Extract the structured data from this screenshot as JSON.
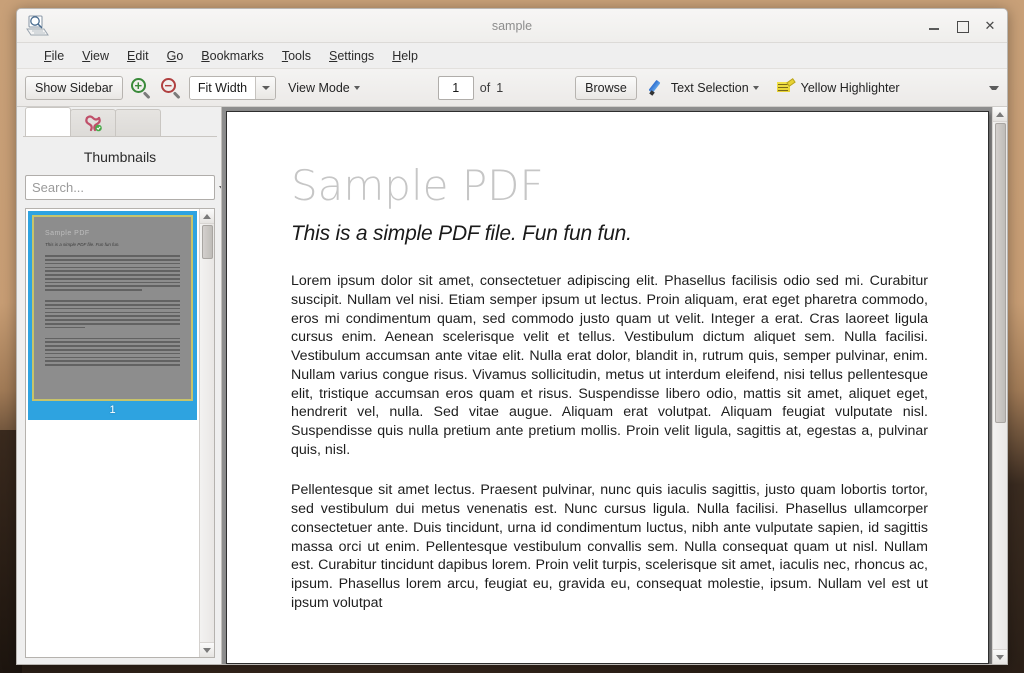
{
  "window": {
    "title": "sample",
    "app_icon": "okular-icon",
    "controls": {
      "minimize": "minimize-button",
      "maximize": "maximize-button",
      "close": "✕"
    }
  },
  "menubar": {
    "items": [
      {
        "label": "File",
        "mnemonic": "F"
      },
      {
        "label": "View",
        "mnemonic": "V"
      },
      {
        "label": "Edit",
        "mnemonic": "E"
      },
      {
        "label": "Go",
        "mnemonic": "G"
      },
      {
        "label": "Bookmarks",
        "mnemonic": "B"
      },
      {
        "label": "Tools",
        "mnemonic": "T"
      },
      {
        "label": "Settings",
        "mnemonic": "S"
      },
      {
        "label": "Help",
        "mnemonic": "H"
      }
    ]
  },
  "toolbar": {
    "show_sidebar": "Show Sidebar",
    "zoom_in_icon": "zoom-in-icon",
    "zoom_out_icon": "zoom-out-icon",
    "zoom_level": "Fit Width",
    "view_mode": "View Mode",
    "page_current": "1",
    "page_of": "of",
    "page_total": "1",
    "browse": "Browse",
    "text_selection": "Text Selection",
    "highlighter": "Yellow Highlighter"
  },
  "sidebar": {
    "tabs": [
      {
        "name": "thumbnails-tab",
        "icon": "",
        "active": true
      },
      {
        "name": "bookmarks-tab",
        "icon": "bookmark-icon",
        "active": false
      },
      {
        "name": "extra-tab",
        "icon": "",
        "active": false
      }
    ],
    "panel_title": "Thumbnails",
    "search": {
      "value": "",
      "placeholder": "Search..."
    },
    "thumbnails": [
      {
        "page_number": "1",
        "selected": true,
        "preview_title": "Sample PDF",
        "preview_subtitle": "This is a simple PDF file. Fun fun fun."
      }
    ]
  },
  "document": {
    "title": "Sample PDF",
    "subtitle": "This is a simple PDF file. Fun fun fun.",
    "paragraphs": [
      "Lorem ipsum dolor sit amet, consectetuer adipiscing elit. Phasellus facilisis odio sed mi. Curabitur suscipit. Nullam vel nisi. Etiam semper ipsum ut lectus. Proin aliquam, erat eget pharetra commodo, eros mi condimentum quam, sed commodo justo quam ut velit. Integer a erat. Cras laoreet ligula cursus enim. Aenean scelerisque velit et tellus. Vestibulum dictum aliquet sem. Nulla facilisi. Vestibulum accumsan ante vitae elit. Nulla erat dolor, blandit in, rutrum quis, semper pulvinar, enim. Nullam varius congue risus. Vivamus sollicitudin, metus ut interdum eleifend, nisi tellus pellentesque elit, tristique accumsan eros quam et risus. Suspendisse libero odio, mattis sit amet, aliquet eget, hendrerit vel, nulla. Sed vitae augue. Aliquam erat volutpat. Aliquam feugiat vulputate nisl. Suspendisse quis nulla pretium ante pretium mollis. Proin velit ligula, sagittis at, egestas a, pulvinar quis, nisl.",
      "Pellentesque sit amet lectus. Praesent pulvinar, nunc quis iaculis sagittis, justo quam lobortis tortor, sed vestibulum dui metus venenatis est. Nunc cursus ligula. Nulla facilisi. Phasellus ullamcorper consectetuer ante. Duis tincidunt, urna id condimentum luctus, nibh ante vulputate sapien, id sagittis massa orci ut enim. Pellentesque vestibulum convallis sem. Nulla consequat quam ut nisl. Nullam est. Curabitur tincidunt dapibus lorem. Proin velit turpis, scelerisque sit amet, iaculis nec, rhoncus ac, ipsum. Phasellus lorem arcu, feugiat eu, gravida eu, consequat molestie, ipsum. Nullam vel est ut ipsum volutpat"
    ]
  },
  "colors": {
    "selection_blue": "#2ea3e0",
    "page_bg": "#8e8e8e",
    "title_gray": "#c6c6c6",
    "zoom_in_green": "#3a8a3a",
    "zoom_out_red": "#b04040",
    "highlighter_yellow": "#e8d233",
    "pen_blue": "#2e6fd0"
  }
}
